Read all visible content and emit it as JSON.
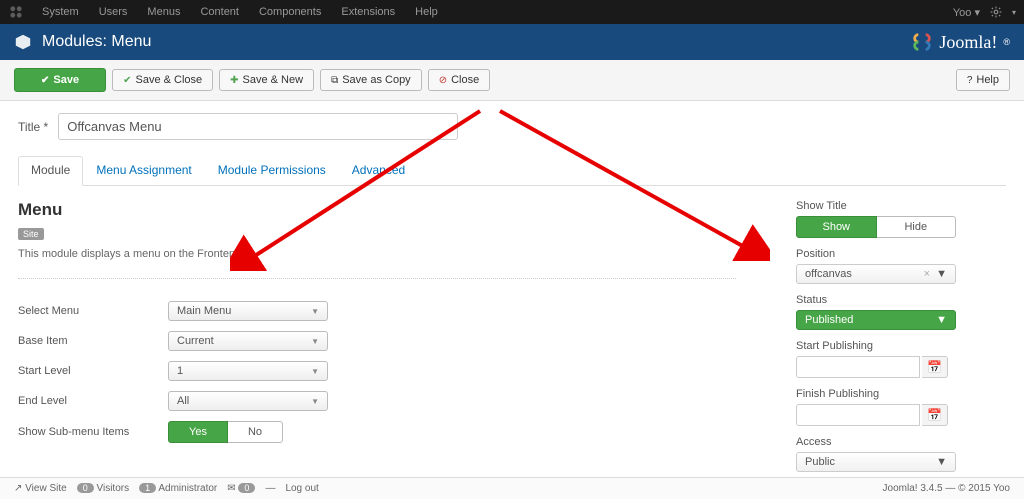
{
  "topnav": {
    "items": [
      "System",
      "Users",
      "Menus",
      "Content",
      "Components",
      "Extensions",
      "Help"
    ],
    "user": "Yoo"
  },
  "header": {
    "title": "Modules: Menu",
    "brand": "Joomla!"
  },
  "buttons": {
    "save": "Save",
    "save_close": "Save & Close",
    "save_new": "Save & New",
    "save_copy": "Save as Copy",
    "close": "Close",
    "help": "Help"
  },
  "title_field": {
    "label": "Title *",
    "value": "Offcanvas Menu"
  },
  "tabs": [
    "Module",
    "Menu Assignment",
    "Module Permissions",
    "Advanced"
  ],
  "module": {
    "heading": "Menu",
    "badge": "Site",
    "desc": "This module displays a menu on the Frontend.",
    "select_menu": {
      "label": "Select Menu",
      "value": "Main Menu"
    },
    "base_item": {
      "label": "Base Item",
      "value": "Current"
    },
    "start_level": {
      "label": "Start Level",
      "value": "1"
    },
    "end_level": {
      "label": "End Level",
      "value": "All"
    },
    "show_submenu": {
      "label": "Show Sub-menu Items",
      "yes": "Yes",
      "no": "No"
    }
  },
  "sidebar": {
    "show_title": {
      "label": "Show Title",
      "show": "Show",
      "hide": "Hide"
    },
    "position": {
      "label": "Position",
      "value": "offcanvas"
    },
    "status": {
      "label": "Status",
      "value": "Published"
    },
    "start_pub": {
      "label": "Start Publishing"
    },
    "finish_pub": {
      "label": "Finish Publishing"
    },
    "access": {
      "label": "Access",
      "value": "Public"
    }
  },
  "footer": {
    "view_site": "View Site",
    "visitors": "Visitors",
    "visitors_n": "0",
    "admin": "Administrator",
    "admin_n": "1",
    "msgs": "0",
    "logout": "Log out",
    "version": "Joomla! 3.4.5 — © 2015 Yoo"
  }
}
